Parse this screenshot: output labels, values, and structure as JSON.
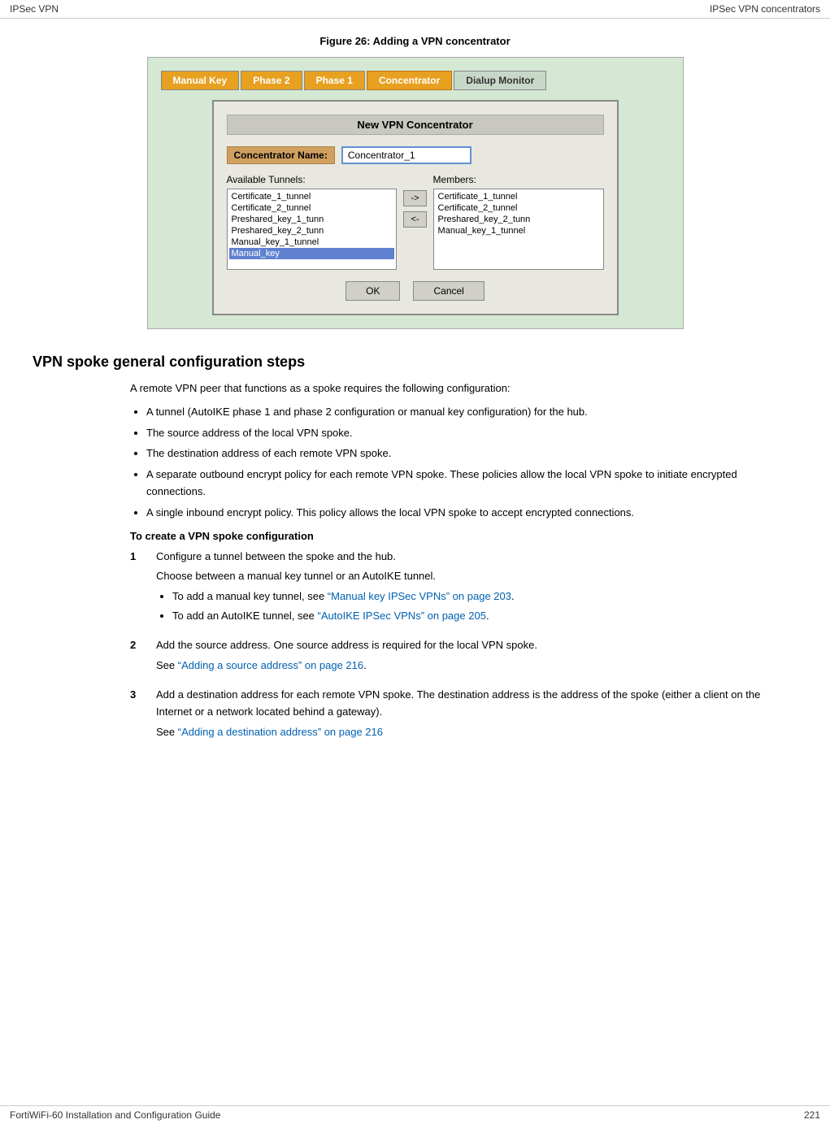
{
  "header": {
    "left": "IPSec VPN",
    "right": "IPSec VPN concentrators"
  },
  "footer": {
    "left": "FortiWiFi-60 Installation and Configuration Guide",
    "right": "221"
  },
  "figure": {
    "caption": "Figure 26: Adding a VPN concentrator",
    "tabs": [
      {
        "label": "Manual Key",
        "active": false,
        "highlight": true
      },
      {
        "label": "Phase 2",
        "active": false,
        "highlight": true
      },
      {
        "label": "Phase 1",
        "active": false,
        "highlight": true
      },
      {
        "label": "Concentrator",
        "active": true,
        "highlight": false
      },
      {
        "label": "Dialup Monitor",
        "active": false,
        "highlight": false
      }
    ],
    "dialog": {
      "title": "New VPN Concentrator",
      "label": "Concentrator Name:",
      "input_value": "Concentrator_1",
      "available_label": "Available Tunnels:",
      "members_label": "Members:",
      "available_tunnels": [
        {
          "label": "Certificate_1_tunnel",
          "selected": false
        },
        {
          "label": "Certificate_2_tunnel",
          "selected": false
        },
        {
          "label": "Preshared_key_1_tunn",
          "selected": false
        },
        {
          "label": "Preshared_key_2_tunn",
          "selected": false
        },
        {
          "label": "Manual_key_1_tunnel",
          "selected": false
        },
        {
          "label": "Manual_key",
          "selected": true
        }
      ],
      "members_tunnels": [
        {
          "label": "Certificate_1_tunnel",
          "selected": false
        },
        {
          "label": "Certificate_2_tunnel",
          "selected": false
        },
        {
          "label": "Preshared_key_2_tunn",
          "selected": false
        },
        {
          "label": "Manual_key_1_tunnel",
          "selected": false
        }
      ],
      "arrow_right": "->",
      "arrow_left": "<-",
      "ok_label": "OK",
      "cancel_label": "Cancel"
    }
  },
  "section": {
    "heading": "VPN spoke general configuration steps",
    "intro": "A remote VPN peer that functions as a spoke requires the following configuration:",
    "bullets": [
      "A tunnel (AutoIKE phase 1 and phase 2 configuration or manual key configuration) for the hub.",
      "The source address of the local VPN spoke.",
      "The destination address of each remote VPN spoke.",
      "A separate outbound encrypt policy for each remote VPN spoke. These policies allow the local VPN spoke to initiate encrypted connections.",
      "A single inbound encrypt policy. This policy allows the local VPN spoke to accept encrypted connections."
    ],
    "subheading": "To create a VPN spoke configuration",
    "steps": [
      {
        "number": "1",
        "text": "Configure a tunnel between the spoke and the hub.",
        "text2": "Choose between a manual key tunnel or an AutoIKE tunnel.",
        "bullets": [
          {
            "text": "To add a manual key tunnel, see ",
            "link": "“Manual key IPSec VPNs” on page 203",
            "text2": "."
          },
          {
            "text": "To add an AutoIKE tunnel, see ",
            "link": "“AutoIKE IPSec VPNs” on page 205",
            "text2": "."
          }
        ]
      },
      {
        "number": "2",
        "text": "Add the source address. One source address is required for the local VPN spoke.",
        "text2": "See ",
        "link": "“Adding a source address” on page 216",
        "text3": "."
      },
      {
        "number": "3",
        "text": "Add a destination address for each remote VPN spoke. The destination address is the address of the spoke (either a client on the Internet or a network located behind a gateway).",
        "text2": "See ",
        "link": "“Adding a destination address” on page 216",
        "text3": ""
      }
    ]
  }
}
